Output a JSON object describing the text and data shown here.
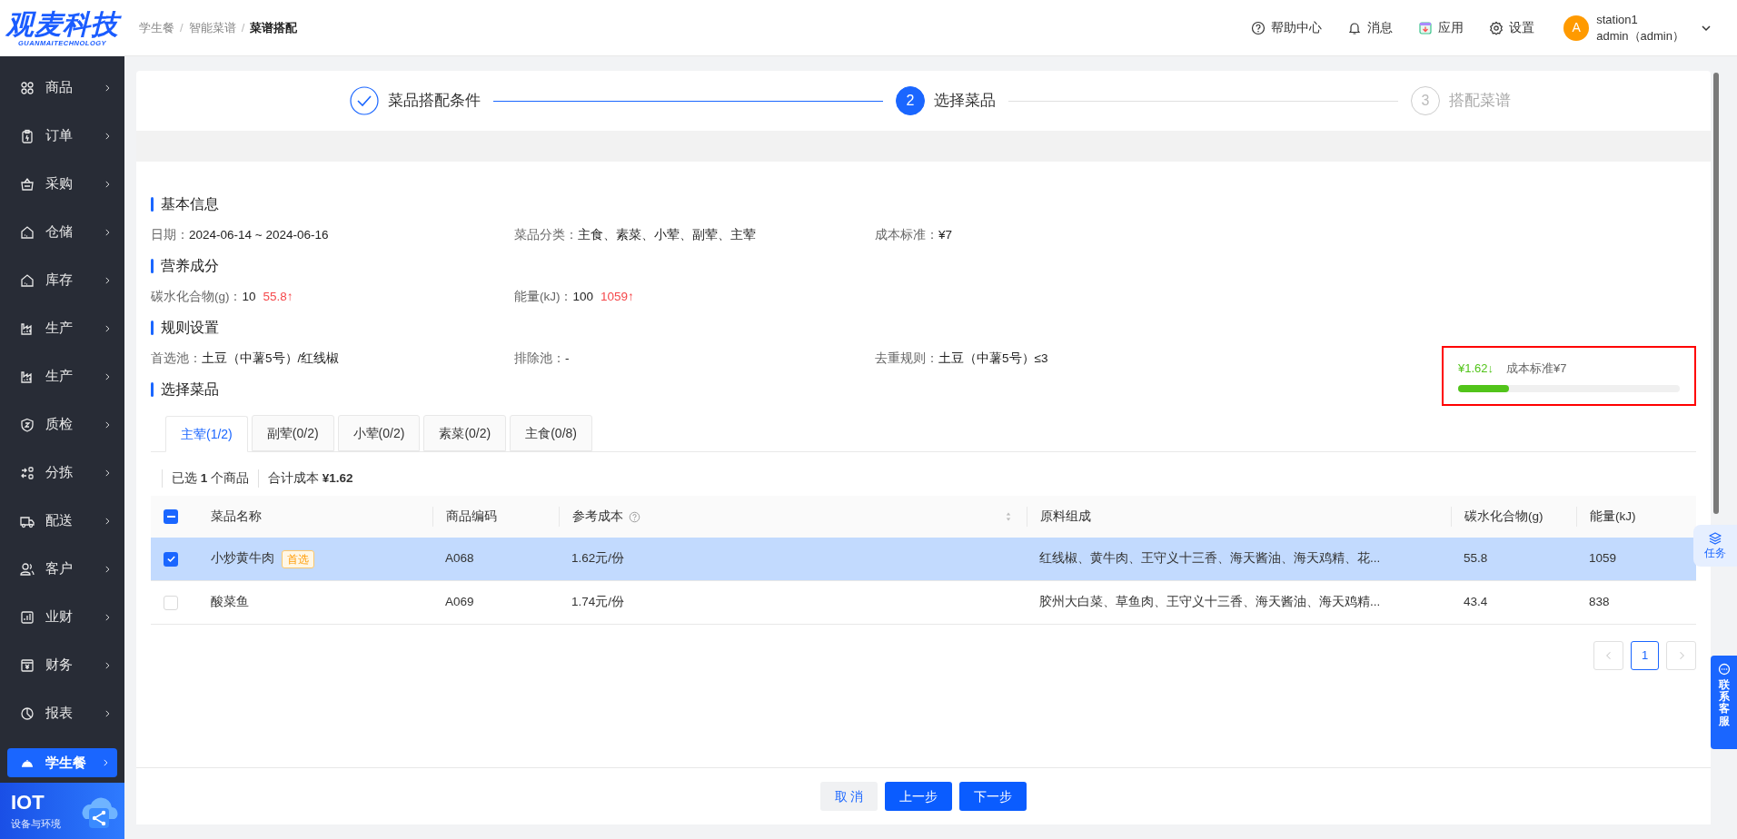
{
  "logo": {
    "title": "观麦科技",
    "subtitle": "GUANMAITECHNOLOGY"
  },
  "sidebar": {
    "items": [
      {
        "label": "商品",
        "selected": false
      },
      {
        "label": "订单",
        "selected": false
      },
      {
        "label": "采购",
        "selected": false
      },
      {
        "label": "仓储",
        "selected": false
      },
      {
        "label": "库存",
        "selected": false
      },
      {
        "label": "生产",
        "selected": false
      },
      {
        "label": "生产",
        "selected": false
      },
      {
        "label": "质检",
        "selected": false
      },
      {
        "label": "分拣",
        "selected": false
      },
      {
        "label": "配送",
        "selected": false
      },
      {
        "label": "客户",
        "selected": false
      },
      {
        "label": "业财",
        "selected": false
      },
      {
        "label": "财务",
        "selected": false
      },
      {
        "label": "报表",
        "selected": false
      },
      {
        "label": "学生餐",
        "selected": true
      }
    ]
  },
  "iot_banner": {
    "title": "IOT",
    "subtitle": "设备与环境"
  },
  "breadcrumb": [
    {
      "label": "学生餐",
      "current": false,
      "separator_after": "/"
    },
    {
      "label": "智能菜谱",
      "current": false,
      "separator_after": "/"
    },
    {
      "label": "菜谱搭配",
      "current": true
    }
  ],
  "header_actions": [
    {
      "label": "帮助中心"
    },
    {
      "label": "消息"
    },
    {
      "label": "应用"
    },
    {
      "label": "设置"
    }
  ],
  "user": {
    "avatar": "A",
    "name": "station1",
    "role": "admin（admin）"
  },
  "steps": [
    {
      "label": "菜品搭配条件",
      "done": true,
      "selected": false
    },
    {
      "number": "2",
      "label": "选择菜品",
      "done": false,
      "selected": true
    },
    {
      "number": "3",
      "label": "搭配菜谱",
      "done": false,
      "selected": false
    }
  ],
  "sections": [
    {
      "title": "基本信息",
      "fields": [
        {
          "label": "日期：",
          "value": "2024-06-14 ~ 2024-06-16"
        },
        {
          "label": "菜品分类：",
          "value": "主食、素菜、小荤、副荤、主荤"
        },
        {
          "label": "成本标准：",
          "value": "¥7"
        }
      ]
    },
    {
      "title": "营养成分",
      "fields": [
        {
          "label": "碳水化合物(g)：",
          "value": "10",
          "actual": "55.8↑"
        },
        {
          "label": "能量(kJ)：",
          "value": "100",
          "actual": "1059↑"
        }
      ]
    },
    {
      "title": "规则设置",
      "fields": [
        {
          "label": "首选池：",
          "value": "土豆（中薯5号）/红线椒"
        },
        {
          "label": "排除池：",
          "value": "-"
        },
        {
          "label": "去重规则：",
          "value": "土豆（中薯5号）≤3"
        }
      ]
    }
  ],
  "dish_section": {
    "title": "选择菜品",
    "cost_meter": {
      "value": "¥1.62↓",
      "standard": "成本标准¥7",
      "level": 0.23,
      "highlighted": true
    },
    "tabs": [
      {
        "label": "主荤(1/2)",
        "selected": true
      },
      {
        "label": "副荤(0/2)",
        "selected": false
      },
      {
        "label": "小荤(0/2)",
        "selected": false
      },
      {
        "label": "素菜(0/2)",
        "selected": false
      },
      {
        "label": "主食(0/8)",
        "selected": false
      }
    ],
    "summary": {
      "selected": "已选 **1** 个商品",
      "total": "合计成本 **¥1.62**"
    },
    "table": {
      "select_all_indeterminate": true,
      "columns": [
        "菜品名称",
        "商品编码",
        "参考成本",
        "原料组成",
        "碳水化合物(g)",
        "能量(kJ)"
      ],
      "rows": [
        {
          "checked": true,
          "name": "小炒黄牛肉",
          "tag": "首选",
          "code": "A068",
          "cost": "1.62元/份",
          "ingredients": "红线椒、黄牛肉、王守义十三香、海天酱油、海天鸡精、花...",
          "carbs": "55.8",
          "energy": "1059"
        },
        {
          "checked": false,
          "name": "酸菜鱼",
          "code": "A069",
          "cost": "1.74元/份",
          "ingredients": "胶州大白菜、草鱼肉、王守义十三香、海天酱油、海天鸡精...",
          "carbs": "43.4",
          "energy": "838"
        }
      ]
    },
    "pagination": [
      {
        "label": "1",
        "selected": true
      }
    ]
  },
  "footer_buttons": [
    {
      "label": "取 消",
      "kind": "secondary"
    },
    {
      "label": "上一步",
      "kind": "primary"
    },
    {
      "label": "下一步",
      "kind": "primary"
    }
  ],
  "task_button": {
    "label": "任务"
  },
  "support_button": {
    "label": "联系客服"
  }
}
